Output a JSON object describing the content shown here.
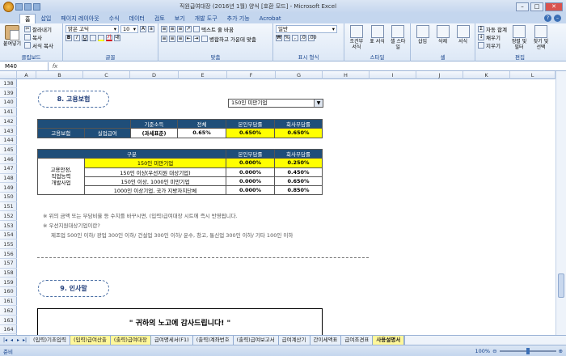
{
  "window": {
    "title": "직원급여대장 (2016년 1월) 양식 [호환 모드] - Microsoft Excel"
  },
  "ribbon_tabs": [
    "홈",
    "삽입",
    "페이지 레이아웃",
    "수식",
    "데이터",
    "검토",
    "보기",
    "개발 도구",
    "추가 기능",
    "Acrobat"
  ],
  "ribbon": {
    "clipboard": {
      "paste": "붙여넣기",
      "cut": "잘라내기",
      "copy": "복사",
      "format_painter": "서식 복사",
      "label": "클립보드"
    },
    "font": {
      "name": "맑은 고딕",
      "size": "10",
      "label": "글꼴"
    },
    "align": {
      "wrap": "텍스트 줄 바꿈",
      "merge": "병합하고 가운데 맞춤",
      "label": "맞춤"
    },
    "number": {
      "format": "일반",
      "label": "표시 형식"
    },
    "styles": {
      "cond": "조건부 서식",
      "table": "표 서식",
      "cell": "셀 스타일",
      "label": "스타일"
    },
    "cells": {
      "insert": "삽입",
      "delete": "삭제",
      "format": "서식",
      "label": "셀"
    },
    "editing": {
      "autosum": "자동 합계",
      "fill": "채우기",
      "clear": "지우기",
      "sort": "정렬 및 필터",
      "find": "찾기 및 선택",
      "label": "편집"
    }
  },
  "namebox": "M40",
  "fx": "fx",
  "columns": [
    "A",
    "B",
    "C",
    "D",
    "E",
    "F",
    "G",
    "H",
    "I",
    "J",
    "K",
    "L"
  ],
  "rows": [
    "138",
    "139",
    "140",
    "141",
    "142",
    "143",
    "144",
    "145",
    "146",
    "147",
    "148",
    "149",
    "150",
    "151",
    "152",
    "153",
    "154",
    "155",
    "156",
    "157",
    "158",
    "159",
    "160",
    "161",
    "162",
    "163",
    "164"
  ],
  "section8": {
    "title": "8. 고용보험",
    "dropdown": "150인 미만기업",
    "table1": {
      "headers": [
        "기준소득",
        "전체",
        "본인부담률",
        "회사부담률"
      ],
      "row": [
        "고용보험",
        "실업급여",
        "(과세표준)",
        "0.65%",
        "0.650%",
        "0.650%"
      ]
    },
    "table2": {
      "headers": [
        "구분",
        "본인부담률",
        "회사부담률"
      ],
      "group": "고용안정,\n직업능력\n개발사업",
      "rows": [
        [
          "150인 미만기업",
          "0.000%",
          "0.250%"
        ],
        [
          "150인 이상(우선지원 대상기업)",
          "0.000%",
          "0.450%"
        ],
        [
          "150인 이상, 1000인 미만기업",
          "0.000%",
          "0.650%"
        ],
        [
          "1000인 이상기업, 국가 지방자치단체",
          "0.000%",
          "0.850%"
        ]
      ]
    },
    "notes": [
      "※ 위의 금액 또는 부담비율 등 수치를 바꾸시면, (입력)급여대장 시트에 즉시 반영됩니다.",
      "※ 우선지원대상기업이란?",
      "제조업 500인 이하/ 광업 300인 이하/ 건설업 300인 이하/ 운수, 창고, 통신업 300인 이하/ 기타 100인 이하"
    ]
  },
  "section9": {
    "title": "9. 인사말",
    "thanks": "\" 귀하의 노고에 감사드립니다! \""
  },
  "sheet_tabs": [
    "(입력)기초입력",
    "(입력)급여산출",
    "(출력)급여대장",
    "급여명세서(F1)",
    "(출력)계좌번호",
    "(출력)급여보고서",
    "급여계산기",
    "간이세액표",
    "급여조견표",
    "사용설명서"
  ],
  "active_sheet": 9,
  "status": {
    "ready": "준비",
    "zoom": "100%"
  }
}
